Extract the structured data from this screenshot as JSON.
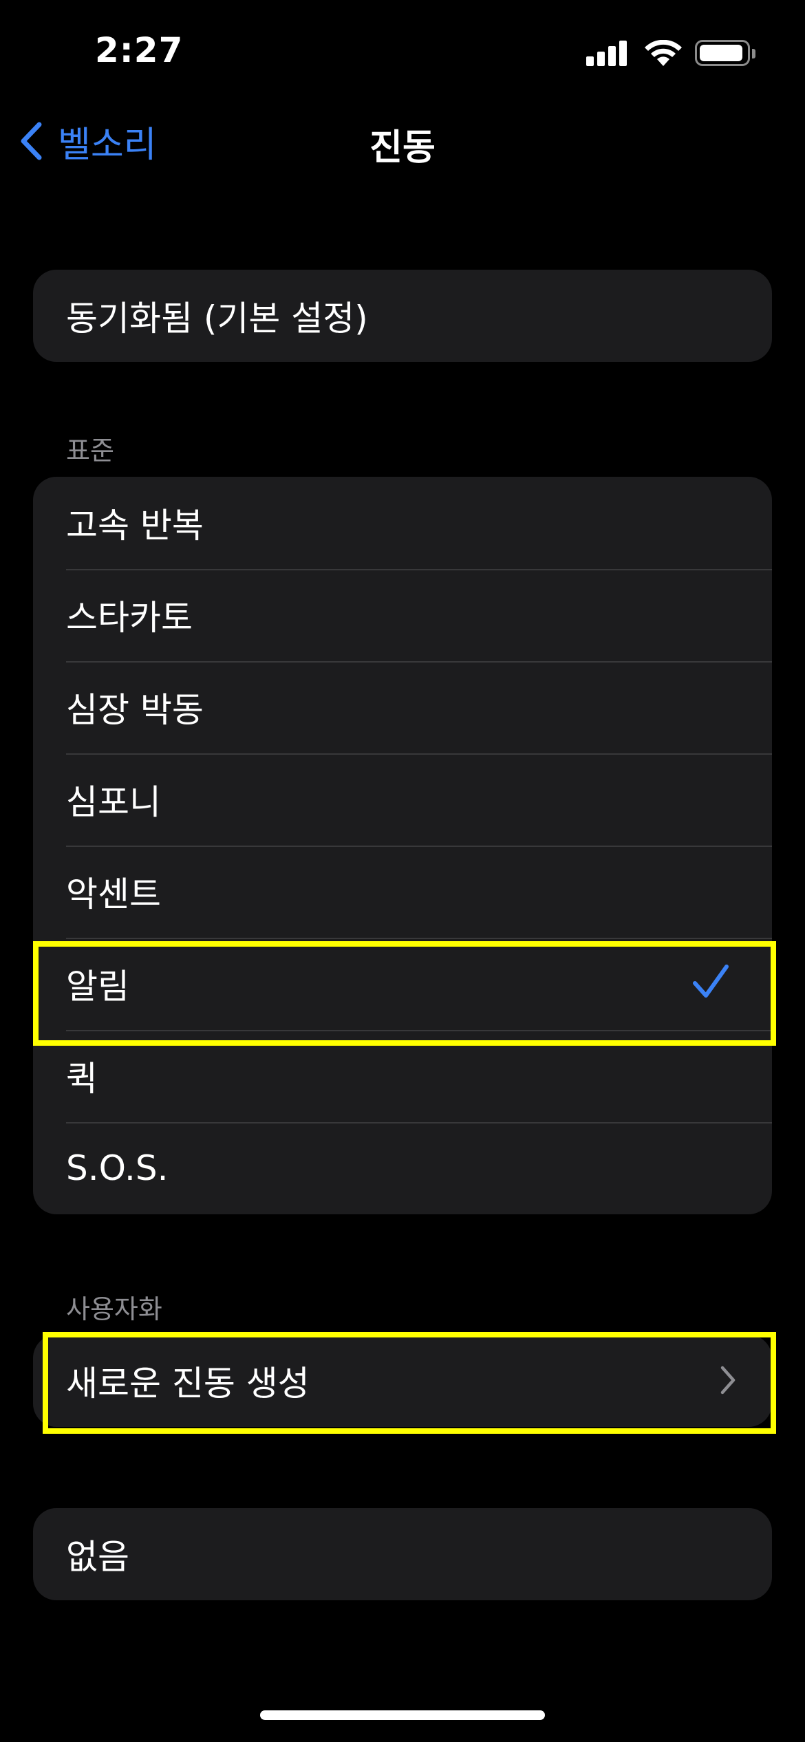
{
  "status_bar": {
    "time": "2:27"
  },
  "nav": {
    "back_label": "벨소리",
    "title": "진동"
  },
  "colors": {
    "accent": "#3b82f6",
    "highlight": "#ffff00",
    "group_background": "#1c1c1e"
  },
  "default_group": {
    "item": "동기화됨 (기본 설정)"
  },
  "standard": {
    "header": "표준",
    "items": [
      {
        "label": "고속 반복",
        "selected": false
      },
      {
        "label": "스타카토",
        "selected": false
      },
      {
        "label": "심장 박동",
        "selected": false
      },
      {
        "label": "심포니",
        "selected": false
      },
      {
        "label": "악센트",
        "selected": false
      },
      {
        "label": "알림",
        "selected": true
      },
      {
        "label": "퀵",
        "selected": false
      },
      {
        "label": "S.O.S.",
        "selected": false
      }
    ]
  },
  "custom": {
    "header": "사용자화",
    "create_label": "새로운 진동 생성"
  },
  "none_group": {
    "item": "없음"
  },
  "icons": {
    "back": "chevron-left-icon",
    "check": "checkmark-icon",
    "disclosure": "chevron-right-icon",
    "signal": "cellular-signal-icon",
    "wifi": "wifi-icon",
    "battery": "battery-icon"
  }
}
